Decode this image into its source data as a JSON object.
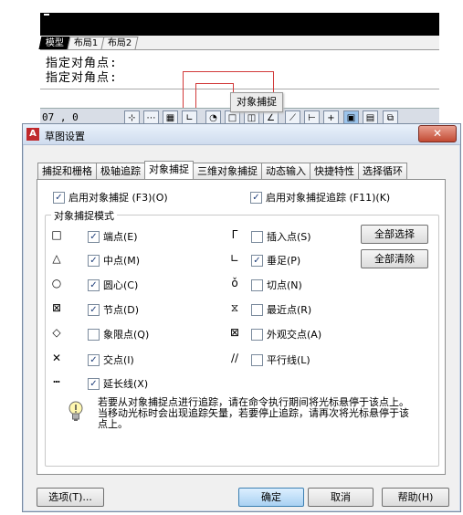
{
  "background": {
    "layout_tabs": [
      "模型",
      "布局1",
      "布局2"
    ],
    "command_lines": [
      "指定对角点:",
      "指定对角点:"
    ],
    "tooltip": "对象捕捉",
    "status_coords": "07 , 0"
  },
  "dialog": {
    "title": "草图设置",
    "app_icon": "autocad-a-icon",
    "close_glyph": "✕",
    "tabs": [
      "捕捉和栅格",
      "极轴追踪",
      "对象捕捉",
      "三维对象捕捉",
      "动态输入",
      "快捷特性",
      "选择循环"
    ],
    "active_tab": "对象捕捉",
    "enable_snap": {
      "label": "启用对象捕捉 (F3)(O)",
      "checked": true
    },
    "enable_tracking": {
      "label": "启用对象捕捉追踪 (F11)(K)",
      "checked": true
    },
    "group_label": "对象捕捉模式",
    "left_modes": [
      {
        "symbol": "□",
        "label": "端点(E)",
        "checked": true
      },
      {
        "symbol": "△",
        "label": "中点(M)",
        "checked": true
      },
      {
        "symbol": "○",
        "label": "圆心(C)",
        "checked": true
      },
      {
        "symbol": "⊠",
        "label": "节点(D)",
        "checked": true
      },
      {
        "symbol": "◇",
        "label": "象限点(Q)",
        "checked": false
      },
      {
        "symbol": "✕",
        "label": "交点(I)",
        "checked": true
      },
      {
        "symbol": "┅",
        "label": "延长线(X)",
        "checked": true
      }
    ],
    "right_modes": [
      {
        "symbol": "ᒥ",
        "label": "插入点(S)",
        "checked": false
      },
      {
        "symbol": "∟",
        "label": "垂足(P)",
        "checked": true
      },
      {
        "symbol": "ǒ",
        "label": "切点(N)",
        "checked": false
      },
      {
        "symbol": "⧖",
        "label": "最近点(R)",
        "checked": false
      },
      {
        "symbol": "⊠",
        "label": "外观交点(A)",
        "checked": false
      },
      {
        "symbol": "∕∕",
        "label": "平行线(L)",
        "checked": false
      }
    ],
    "select_all": "全部选择",
    "clear_all": "全部清除",
    "tip": "若要从对象捕捉点进行追踪，请在命令执行期间将光标悬停于该点上。当移动光标时会出现追踪矢量，若要停止追踪，请再次将光标悬停于该点上。",
    "tip_icon": "lightbulb-icon",
    "options_btn": "选项(T)...",
    "ok_btn": "确定",
    "cancel_btn": "取消",
    "help_btn": "帮助(H)"
  },
  "colors": {
    "accent": "#3c7fb1",
    "close": "#c24a33",
    "highlight": "#d23a3a"
  }
}
